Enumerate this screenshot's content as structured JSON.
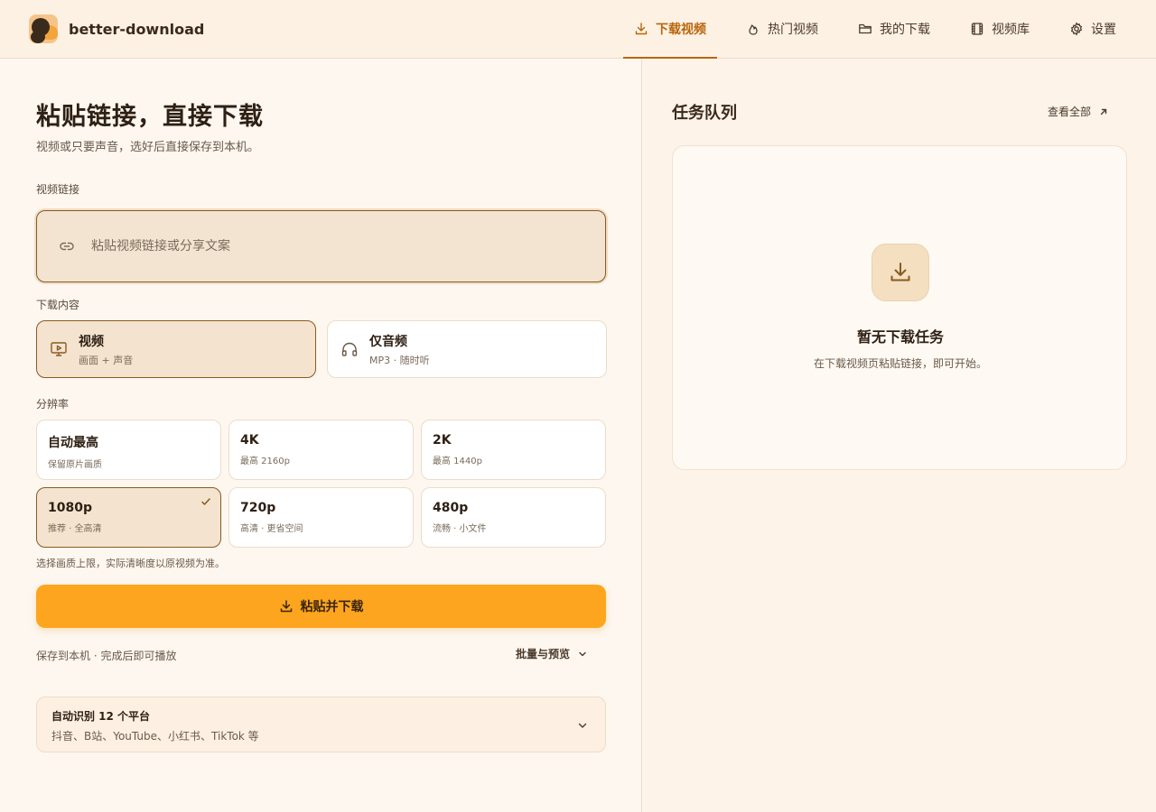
{
  "brand": {
    "name": "better-download"
  },
  "nav": [
    {
      "label": "下载视频",
      "icon": "download-icon",
      "active": true
    },
    {
      "label": "热门视频",
      "icon": "flame-icon",
      "active": false
    },
    {
      "label": "我的下载",
      "icon": "folder-icon",
      "active": false
    },
    {
      "label": "视频库",
      "icon": "film-icon",
      "active": false
    },
    {
      "label": "设置",
      "icon": "gear-icon",
      "active": false
    }
  ],
  "main": {
    "title": "粘贴链接，直接下载",
    "subtitle": "视频或只要声音，选好后直接保存到本机。",
    "url_label": "视频链接",
    "url_placeholder": "粘贴视频链接或分享文案",
    "url_value": "",
    "content_label": "下载内容",
    "modes": [
      {
        "title": "视频",
        "desc": "画面 + 声音",
        "selected": true
      },
      {
        "title": "仅音频",
        "desc": "MP3 · 随时听",
        "selected": false
      }
    ],
    "resolution_label": "分辨率",
    "resolutions": [
      {
        "title": "自动最高",
        "desc": "保留原片画质",
        "selected": false
      },
      {
        "title": "4K",
        "desc": "最高 2160p",
        "selected": false
      },
      {
        "title": "2K",
        "desc": "最高 1440p",
        "selected": false
      },
      {
        "title": "1080p",
        "desc": "推荐 · 全高清",
        "selected": true
      },
      {
        "title": "720p",
        "desc": "高清 · 更省空间",
        "selected": false
      },
      {
        "title": "480p",
        "desc": "流畅 · 小文件",
        "selected": false
      }
    ],
    "resolution_hint": "选择画质上限，实际清晰度以原视频为准。",
    "download_button": "粘贴并下载",
    "footnote": "保存到本机 · 完成后即可播放",
    "batch_label": "批量与预览",
    "platforms": {
      "title": "自动识别 12 个平台",
      "desc": "抖音、B站、YouTube、小红书、TikTok 等"
    }
  },
  "queue": {
    "title": "任务队列",
    "view_all": "查看全部",
    "empty_title": "暂无下载任务",
    "empty_sub": "在下载视频页粘贴链接，即可开始。"
  },
  "colors": {
    "accent": "#b8660a",
    "button": "#fda51e",
    "selected_bg": "#f3e3cf",
    "selected_border": "#8a5a20"
  }
}
